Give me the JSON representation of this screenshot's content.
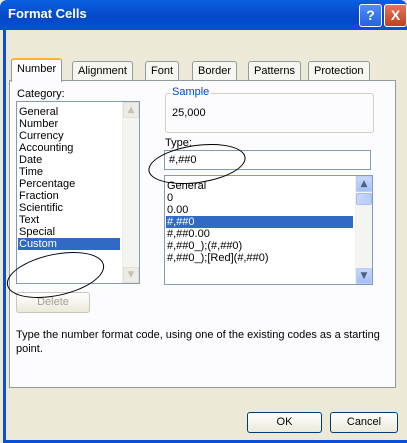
{
  "window": {
    "title": "Format Cells",
    "help_glyph": "?",
    "close_glyph": "X"
  },
  "tabs": [
    {
      "label": "Number",
      "active": true
    },
    {
      "label": "Alignment"
    },
    {
      "label": "Font"
    },
    {
      "label": "Border"
    },
    {
      "label": "Patterns"
    },
    {
      "label": "Protection"
    }
  ],
  "category": {
    "label": "Category:",
    "items": [
      "General",
      "Number",
      "Currency",
      "Accounting",
      "Date",
      "Time",
      "Percentage",
      "Fraction",
      "Scientific",
      "Text",
      "Special",
      "Custom"
    ],
    "selected": "Custom"
  },
  "sample": {
    "legend": "Sample",
    "value": "25,000"
  },
  "type": {
    "label": "Type:",
    "value": "#,##0",
    "list": [
      "General",
      "0",
      "0.00",
      "#,##0",
      "#,##0.00",
      "#,##0_);(#,##0)",
      "#,##0_);[Red](#,##0)"
    ],
    "selected": "#,##0"
  },
  "delete_label": "Delete",
  "description": "Type the number format code, using one of the existing codes as a starting point.",
  "buttons": {
    "ok": "OK",
    "cancel": "Cancel"
  },
  "colors": {
    "title_bar": "#0a4fd8",
    "selection": "#316ac5",
    "legend_text": "#0046d5",
    "active_tab_accent": "#f8b33a"
  },
  "icons": {
    "scroll_up": "▲",
    "scroll_down": "▼"
  }
}
